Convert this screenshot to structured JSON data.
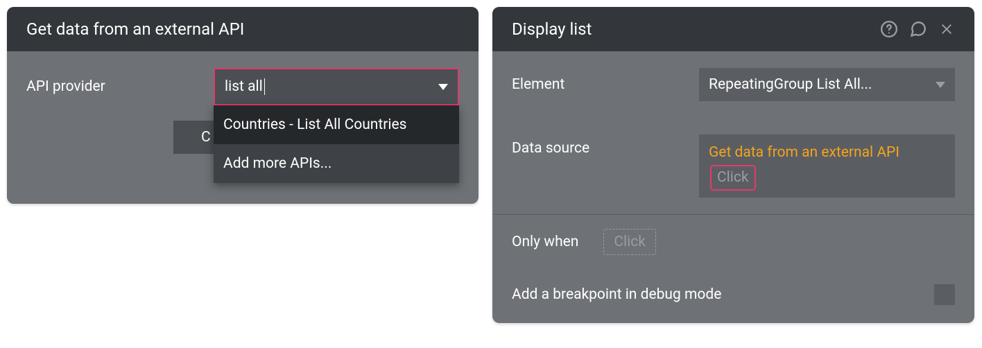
{
  "left_panel": {
    "title": "Get data from an external API",
    "api_provider_label": "API provider",
    "api_provider_value": "list all",
    "dropdown": {
      "option_0": "Countries - List All Countries",
      "option_1": "Add more APIs..."
    },
    "cancel_label": "C"
  },
  "right_panel": {
    "title": "Display list",
    "element_label": "Element",
    "element_value": "RepeatingGroup List All...",
    "data_source_label": "Data source",
    "data_source_expr": "Get data from an external API",
    "click_label": "Click",
    "only_when_label": "Only when",
    "only_when_click": "Click",
    "breakpoint_label": "Add a breakpoint in debug mode"
  }
}
